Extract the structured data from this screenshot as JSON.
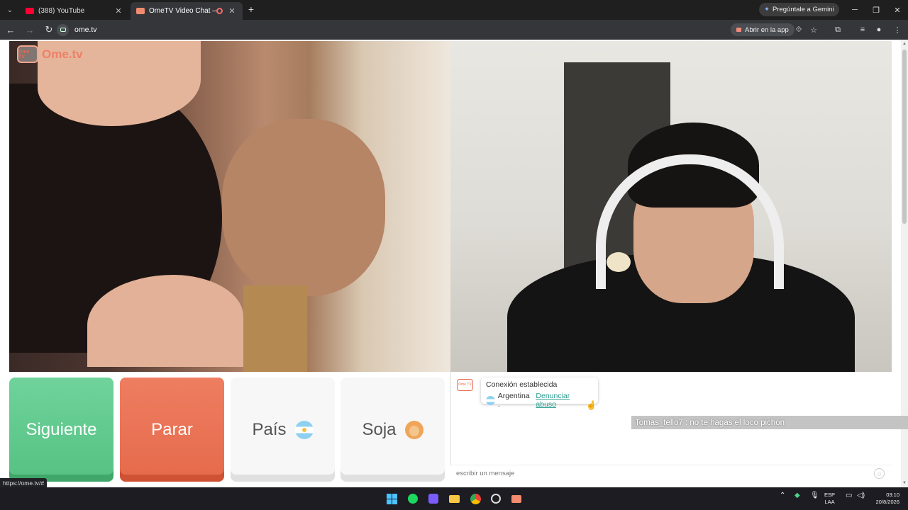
{
  "browser": {
    "tabs": [
      {
        "title": "(388) YouTube",
        "favicon": "youtube-icon",
        "close": "✕"
      },
      {
        "title": "OmeTV Video Chat — Alter",
        "favicon": "ometv-icon",
        "close": "✕",
        "recording": true
      }
    ],
    "new_tab": "+",
    "gemini_label": "Pregúntale a Gemini",
    "url": "ome.tv",
    "open_app_label": "Abrir en la app",
    "status_url": "https://ome.tv/#"
  },
  "page": {
    "logo_text": "Ome.tv",
    "logo_small": "Ome TV",
    "buttons": {
      "next": "Siguiente",
      "stop": "Parar",
      "country": "País",
      "gender": "Soja"
    },
    "chat": {
      "logo_small": "Ome TV",
      "connection": "Conexión establecida",
      "country": "Argentina .",
      "report": "Denunciar abuso",
      "report_suffix": ".",
      "message_user": "Tomas_tello7",
      "message_sep": " : ",
      "message_text": "no te hagas el loco pichón",
      "input_placeholder": "escribir un mensaje"
    }
  },
  "taskbar": {
    "lang_line1": "ESP",
    "lang_line2": "LAA",
    "time": "03:10",
    "date": "20/8/2026"
  },
  "colors": {
    "next": "#5ec98c",
    "stop": "#e9704f",
    "brand": "#ef8066",
    "link": "#2a9d8f"
  }
}
